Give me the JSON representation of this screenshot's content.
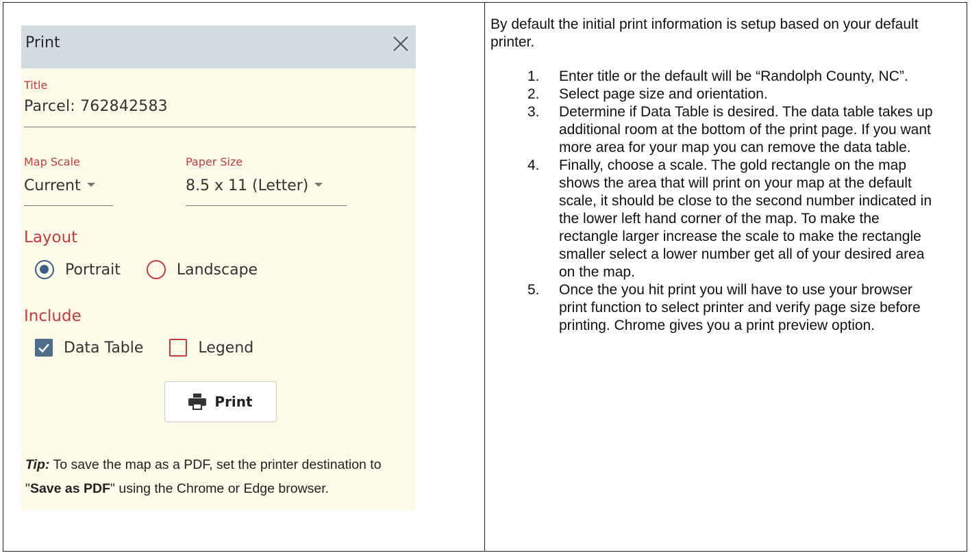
{
  "dialog": {
    "title": "Print",
    "title_field": {
      "label": "Title",
      "value": "Parcel: 762842583"
    },
    "map_scale": {
      "label": "Map Scale",
      "value": "Current"
    },
    "paper_size": {
      "label": "Paper Size",
      "value": "8.5 x 11 (Letter)"
    },
    "layout": {
      "heading": "Layout",
      "options": [
        {
          "label": "Portrait",
          "selected": true
        },
        {
          "label": "Landscape",
          "selected": false
        }
      ]
    },
    "include": {
      "heading": "Include",
      "options": [
        {
          "label": "Data Table",
          "checked": true
        },
        {
          "label": "Legend",
          "checked": false
        }
      ]
    },
    "print_button": "Print",
    "tip": {
      "label": "Tip:",
      "text_before": "To save the map as a PDF, set the printer destination to \"",
      "bold": "Save as PDF",
      "text_after": "\" using the Chrome or Edge browser."
    }
  },
  "instructions": {
    "intro": "By default the initial print information is setup based on your default printer.",
    "steps": [
      {
        "num": "1.",
        "text": "Enter title or the default will be “Randolph County, NC”."
      },
      {
        "num": "2.",
        "text": "Select page size and orientation."
      },
      {
        "num": "3.",
        "text": "Determine if Data Table is desired. The data table takes up additional room at the bottom of the print page. If you want more area for your map you can remove the data table."
      },
      {
        "num": "4.",
        "text": "Finally, choose a scale.  The gold rectangle on the map shows the area that will print on your map at the default scale, it should be close to the second number indicated in the lower left hand corner of the map.  To make the rectangle larger increase the scale to make the rectangle smaller select a lower number get all of your desired area on the map."
      },
      {
        "num": "5.",
        "text": "Once the you hit print you will have to use your browser print function to select printer and verify page size before printing.  Chrome gives you a print preview option."
      }
    ]
  },
  "colors": {
    "accent_red": "#c9393f",
    "accent_blue": "#3b5f87",
    "panel_bg": "#fefbe8",
    "header_bg": "#d2dde3"
  }
}
